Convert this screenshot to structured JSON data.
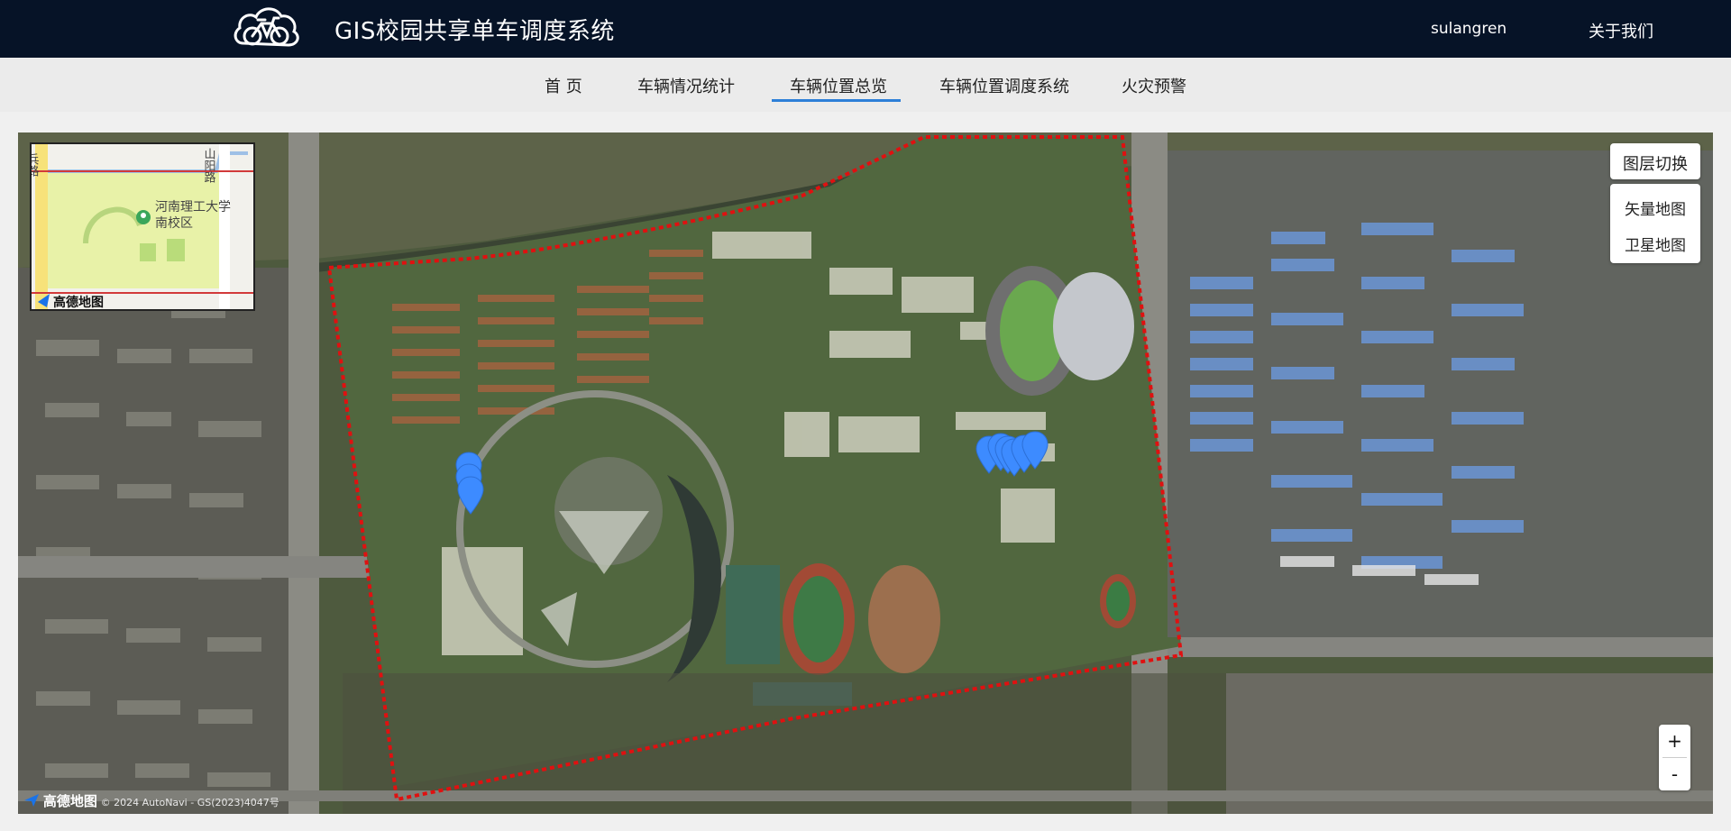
{
  "header": {
    "app_title": "GIS校园共享单车调度系统",
    "user_name": "sulangren",
    "about_label": "关于我们"
  },
  "nav": {
    "items": [
      {
        "label": "首 页"
      },
      {
        "label": "车辆情况统计"
      },
      {
        "label": "车辆位置总览",
        "active": true
      },
      {
        "label": "车辆位置调度系统"
      },
      {
        "label": "火灾预警"
      }
    ]
  },
  "minimap": {
    "poi_label_line1": "河南理工大学",
    "poi_label_line2": "南校区",
    "road_label_left": "兵路",
    "road_label_right": "山阳路",
    "brand": "高德地图"
  },
  "layer_switch": {
    "title": "图层切换",
    "options": [
      "矢量地图",
      "卫星地图"
    ]
  },
  "zoom": {
    "in_label": "+",
    "out_label": "-"
  },
  "attribution": {
    "brand": "高德地图",
    "copyright": "© 2024 AutoNavi - GS(2023)4047号"
  },
  "colors": {
    "topbar": "#061327",
    "nav_active": "#2d7fd8",
    "boundary": "#e01010",
    "marker": "#3d8bff"
  },
  "map": {
    "type": "satellite",
    "markers_count": 9
  }
}
